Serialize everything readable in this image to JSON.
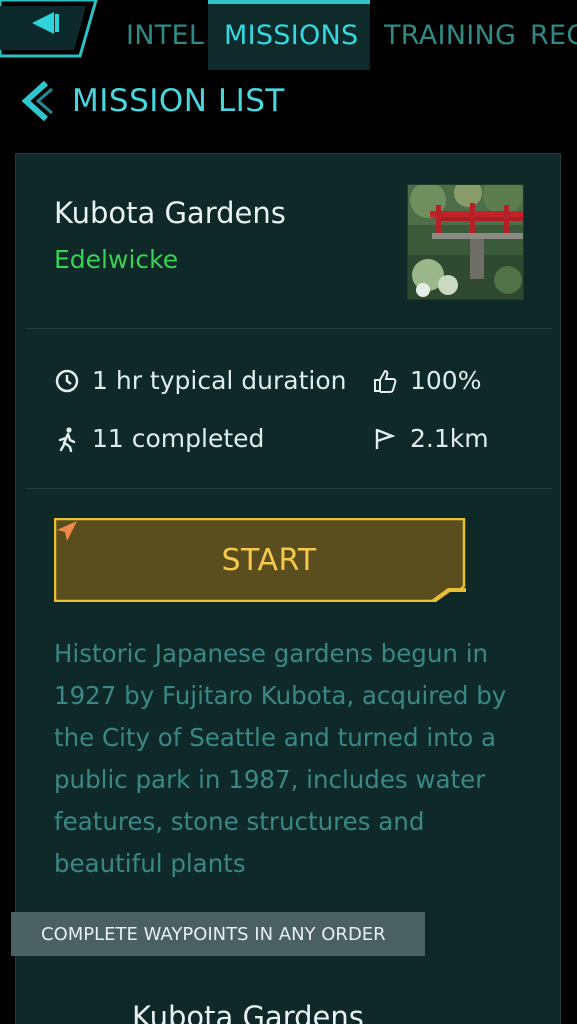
{
  "nav": {
    "tabs": [
      {
        "label": "INTEL",
        "active": false
      },
      {
        "label": "MISSIONS",
        "active": true
      },
      {
        "label": "TRAINING",
        "active": false
      },
      {
        "label": "REC",
        "active": false
      }
    ]
  },
  "header": {
    "title": "MISSION LIST"
  },
  "mission": {
    "title": "Kubota Gardens",
    "author": "Edelwicke",
    "stats": {
      "duration": "1 hr typical duration",
      "rating": "100%",
      "completed": "11 completed",
      "distance": "2.1km"
    },
    "start_label": "START",
    "description": "Historic Japanese gardens begun in 1927 by Fujitaro Kubota, acquired by the City of Seattle and turned into a public park in 1987, includes water features, stone structures and beautiful plants",
    "waypoint_order": "COMPLETE WAYPOINTS IN ANY ORDER",
    "waypoint_title": "Kubota Gardens"
  },
  "colors": {
    "accent": "#33d9e0",
    "author_green": "#39d254",
    "start_gold": "#f6c94b",
    "card_bg": "#0f2828"
  },
  "icons": {
    "back": "back-arrow-icon",
    "header": "chevron-left-icon",
    "duration": "clock-icon",
    "rating": "thumbs-up-icon",
    "completed": "walking-person-icon",
    "distance": "flag-icon",
    "start": "navigation-arrow-icon"
  }
}
